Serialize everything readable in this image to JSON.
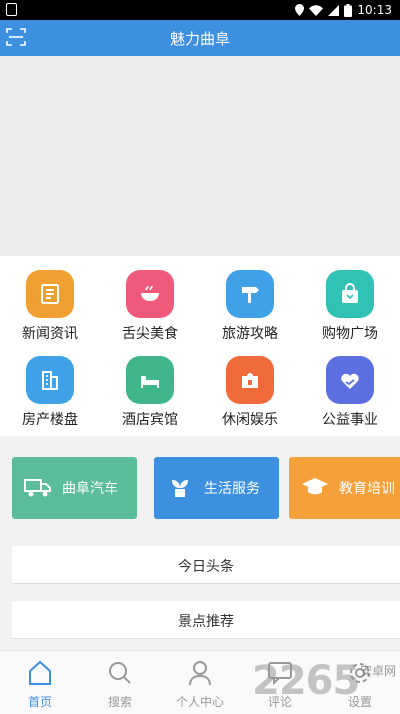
{
  "status_bar": {
    "time": "10:13"
  },
  "header": {
    "title": "魅力曲阜"
  },
  "grid_items": [
    {
      "label": "新闻资讯",
      "color": "#f0a030",
      "icon": "news-icon"
    },
    {
      "label": "舌尖美食",
      "color": "#f05a7a",
      "icon": "food-bowl-icon"
    },
    {
      "label": "旅游攻略",
      "color": "#3fa2e8",
      "icon": "signpost-icon"
    },
    {
      "label": "购物广场",
      "color": "#30c2b4",
      "icon": "shopping-bag-icon"
    },
    {
      "label": "房产楼盘",
      "color": "#3fa2e8",
      "icon": "building-icon"
    },
    {
      "label": "酒店宾馆",
      "color": "#3fb58a",
      "icon": "bed-icon"
    },
    {
      "label": "休闲娱乐",
      "color": "#f06a3a",
      "icon": "puzzle-icon"
    },
    {
      "label": "公益事业",
      "color": "#5b6fe0",
      "icon": "heart-hand-icon"
    }
  ],
  "feature_cards": [
    {
      "label": "曲阜汽车",
      "color": "#5bbc9a",
      "icon": "truck-icon"
    },
    {
      "label": "生活服务",
      "color": "#3d8fe0",
      "icon": "plant-icon"
    },
    {
      "label": "教育培训",
      "color": "#f5a03a",
      "icon": "graduation-cap-icon"
    }
  ],
  "sections": [
    "今日头条",
    "景点推荐"
  ],
  "tabs": [
    {
      "label": "首页",
      "icon": "home-icon",
      "active": true
    },
    {
      "label": "搜索",
      "icon": "search-icon",
      "active": false
    },
    {
      "label": "个人中心",
      "icon": "person-icon",
      "active": false
    },
    {
      "label": "评论",
      "icon": "comment-icon",
      "active": false
    },
    {
      "label": "设置",
      "icon": "settings-icon",
      "active": false
    }
  ],
  "watermark": {
    "big": "2265",
    "small": "安卓网"
  }
}
